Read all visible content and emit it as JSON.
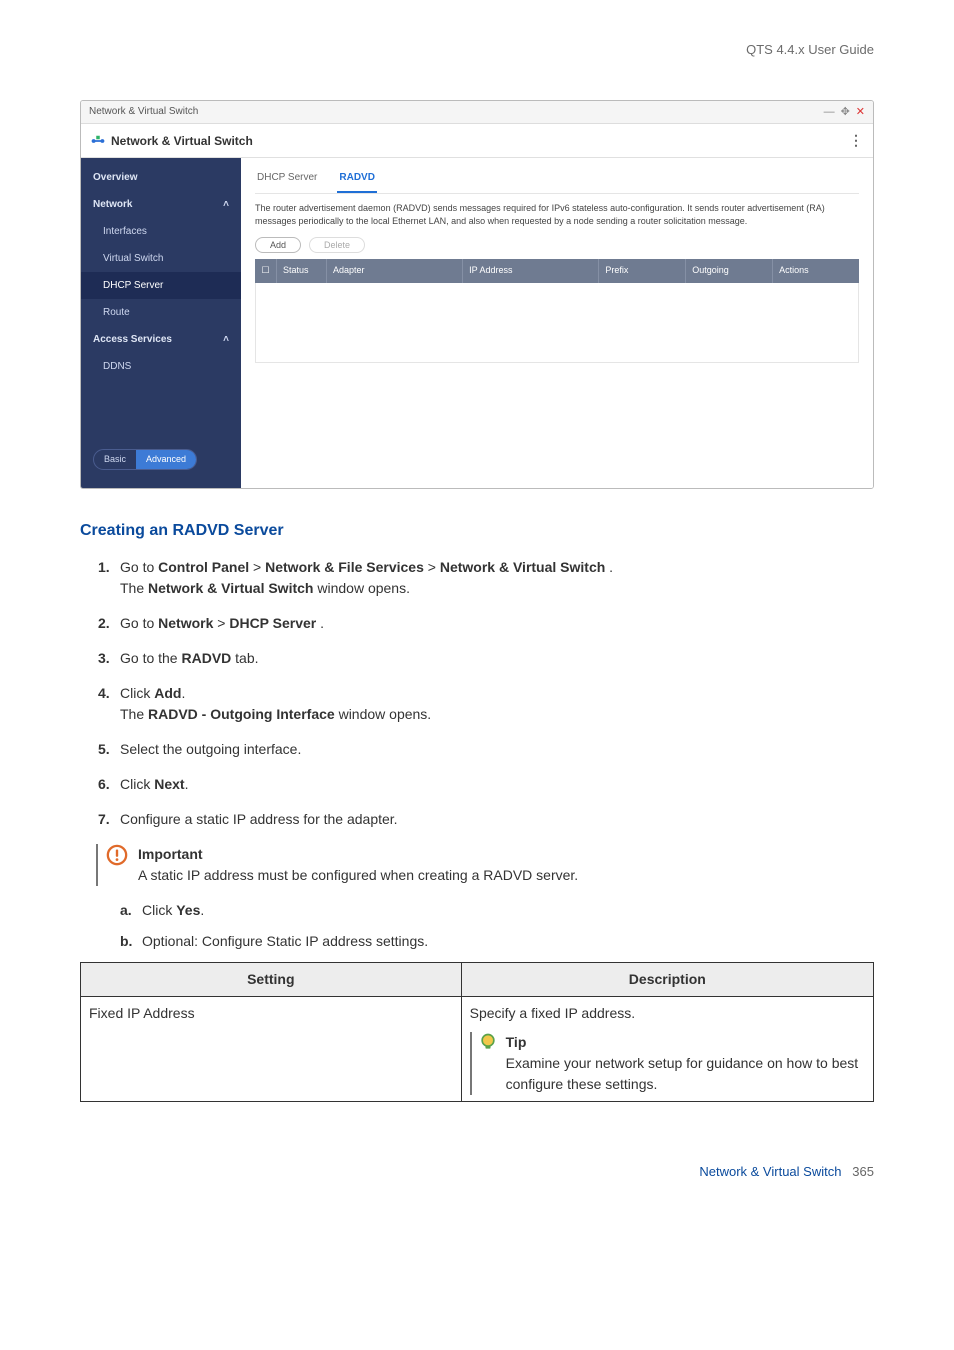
{
  "header": {
    "guide_title": "QTS 4.4.x User Guide"
  },
  "window": {
    "titlebar": "Network & Virtual Switch",
    "app_title": "Network & Virtual Switch",
    "sidebar": {
      "overview": "Overview",
      "network": "Network",
      "interfaces": "Interfaces",
      "virtual_switch": "Virtual Switch",
      "dhcp_server": "DHCP Server",
      "route": "Route",
      "access_services": "Access Services",
      "ddns": "DDNS",
      "toggle_basic": "Basic",
      "toggle_advanced": "Advanced"
    },
    "tabs": {
      "dhcp": "DHCP Server",
      "radvd": "RADVD"
    },
    "desc": "The router advertisement daemon (RADVD) sends messages required for IPv6 stateless auto-configuration. It sends router advertisement (RA) messages periodically to the local Ethernet LAN, and also when requested by a node sending a router solicitation message.",
    "buttons": {
      "add": "Add",
      "delete": "Delete"
    },
    "columns": {
      "checkbox": "☐",
      "status": "Status",
      "adapter": "Adapter",
      "ip": "IP Address",
      "prefix": "Prefix",
      "outgoing": "Outgoing",
      "actions": "Actions"
    }
  },
  "doc": {
    "heading": "Creating an RADVD Server",
    "steps": {
      "s1a": "Go to ",
      "s1_cp": "Control Panel",
      "s1_sep": " > ",
      "s1_nfs": "Network & File Services",
      "s1_nvs": "Network & Virtual Switch",
      "s1_period": " .",
      "s1b": "The ",
      "s1b_bold": "Network & Virtual Switch",
      "s1b_end": " window opens.",
      "s2a": "Go to ",
      "s2_net": "Network",
      "s2_dhcp": "DHCP Server",
      "s2_period": " .",
      "s3a": "Go to the ",
      "s3_bold": "RADVD",
      "s3_end": " tab.",
      "s4a": "Click ",
      "s4_bold": "Add",
      "s4_period": ".",
      "s4b": "The ",
      "s4b_bold": "RADVD - Outgoing Interface",
      "s4b_end": " window opens.",
      "s5": "Select the outgoing interface.",
      "s6a": "Click ",
      "s6_bold": "Next",
      "s6_period": ".",
      "s7": "Configure a static IP address for the adapter."
    },
    "important": {
      "title": "Important",
      "text": "A static IP address must be configured when creating a RADVD server."
    },
    "substeps": {
      "a_pre": "Click ",
      "a_bold": "Yes",
      "a_post": ".",
      "b": "Optional: Configure Static IP address settings."
    },
    "table": {
      "h1": "Setting",
      "h2": "Description",
      "r1c1": "Fixed IP Address",
      "r1c2": "Specify a fixed IP address.",
      "tip_title": "Tip",
      "tip_text": "Examine your network setup for guidance on how to best configure these settings."
    }
  },
  "footer": {
    "section": "Network & Virtual Switch",
    "page": "365"
  }
}
